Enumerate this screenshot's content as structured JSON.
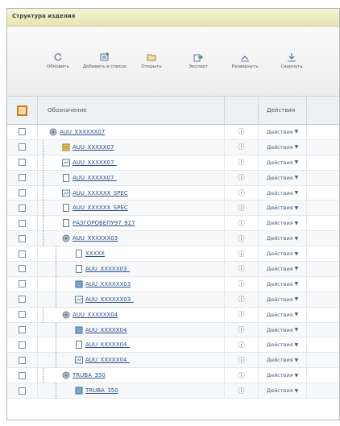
{
  "panel": {
    "title": "Структура изделия"
  },
  "toolbar": {
    "buttons": [
      {
        "label": "Обновить",
        "icon": "refresh-icon"
      },
      {
        "label": "Добавить в список",
        "icon": "add-to-list-icon"
      },
      {
        "label": "Открыть",
        "icon": "open-icon"
      },
      {
        "label": "Экспорт",
        "icon": "export-icon"
      },
      {
        "label": "Развернуть",
        "icon": "expand-icon"
      },
      {
        "label": "Свернуть",
        "icon": "collapse-icon"
      }
    ]
  },
  "grid": {
    "columns": {
      "name": "Обозначение",
      "actions": "Действия"
    },
    "rows": [
      {
        "name": "AUU_XXXXXX07",
        "level": 0,
        "icon": "assembly-icon",
        "action": "Действия"
      },
      {
        "name": "AUU_XXXXX07",
        "level": 1,
        "icon": "part-yellow-icon",
        "action": "Действия"
      },
      {
        "name": "AUU_XXXXX07_",
        "level": 1,
        "icon": "drawing-icon",
        "action": "Действия"
      },
      {
        "name": "AUU_XXXXX07_",
        "level": 1,
        "icon": "document-icon",
        "action": "Действия"
      },
      {
        "name": "AUU_XXXXXX_SPEC",
        "level": 1,
        "icon": "drawing-icon",
        "action": "Действия"
      },
      {
        "name": "AUU_XXXXXX_SPEC",
        "level": 1,
        "icon": "document-icon",
        "action": "Действия"
      },
      {
        "name": "РАЗГОРОБЕПУ97_927",
        "level": 1,
        "icon": "document-icon",
        "action": "Действия"
      },
      {
        "name": "AUU_XXXXXX03",
        "level": 1,
        "icon": "assembly-icon",
        "action": "Действия"
      },
      {
        "name": "XXXXX",
        "level": 2,
        "icon": "document-icon",
        "action": "Действия"
      },
      {
        "name": "AUU_XXXXX03_",
        "level": 2,
        "icon": "document-icon",
        "action": "Действия"
      },
      {
        "name": "AUU_XXXXXX03",
        "level": 2,
        "icon": "part-blue-icon",
        "action": "Действия"
      },
      {
        "name": "AUU_XXXXXX03_",
        "level": 2,
        "icon": "drawing-icon",
        "action": "Действия"
      },
      {
        "name": "AUU_XXXXXX04",
        "level": 1,
        "icon": "assembly-icon",
        "action": "Действия"
      },
      {
        "name": "AUU_XXXXX04",
        "level": 2,
        "icon": "part-blue-icon",
        "action": "Действия"
      },
      {
        "name": "AUU_XXXXX04_",
        "level": 2,
        "icon": "document-icon",
        "action": "Действия"
      },
      {
        "name": "AUU_XXXXX04_",
        "level": 2,
        "icon": "drawing-icon",
        "action": "Действия"
      },
      {
        "name": "TRUBA_350",
        "level": 1,
        "icon": "assembly-icon",
        "action": "Действия"
      },
      {
        "name": "TRUBA_350",
        "level": 2,
        "icon": "part-blue-icon",
        "action": "Действия"
      }
    ]
  },
  "colors": {
    "header_bg": "#e8e4b2",
    "link": "#2b4f8a",
    "select_accent": "#c37a1c"
  }
}
